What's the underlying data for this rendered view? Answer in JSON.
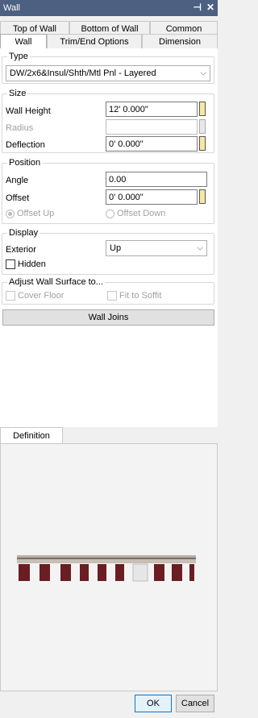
{
  "window": {
    "title": "Wall",
    "pin_icon": "pin-icon",
    "close_icon": "close-icon"
  },
  "tabs": {
    "row1": [
      {
        "label": "Top of Wall"
      },
      {
        "label": "Bottom of Wall"
      },
      {
        "label": "Common"
      }
    ],
    "row2": [
      {
        "label": "Wall",
        "active": true
      },
      {
        "label": "Trim/End Options"
      },
      {
        "label": "Dimension"
      }
    ]
  },
  "type_group": {
    "legend": "Type",
    "selected": "DW/2x6&Insul/Shth/Mtl Pnl - Layered"
  },
  "size_group": {
    "legend": "Size",
    "wall_height_label": "Wall Height",
    "wall_height_value": "12' 0.000\"",
    "radius_label": "Radius",
    "radius_value": "",
    "deflection_label": "Deflection",
    "deflection_value": "0' 0.000\""
  },
  "position_group": {
    "legend": "Position",
    "angle_label": "Angle",
    "angle_value": "0.00",
    "offset_label": "Offset",
    "offset_value": "0' 0.000\"",
    "offset_up_label": "Offset Up",
    "offset_down_label": "Offset Down"
  },
  "display_group": {
    "legend": "Display",
    "exterior_label": "Exterior",
    "exterior_value": "Up",
    "hidden_label": "Hidden"
  },
  "adjust_group": {
    "legend": "Adjust Wall Surface to...",
    "cover_floor_label": "Cover Floor",
    "fit_to_soffit_label": "Fit to Soffit"
  },
  "wall_joins_label": "Wall Joins",
  "definition_tab_label": "Definition",
  "footer": {
    "ok_label": "OK",
    "cancel_label": "Cancel"
  },
  "colors": {
    "titlebar": "#4d6082",
    "stud_fill": "#6a1e22",
    "wall_top": "#a89a8a"
  }
}
